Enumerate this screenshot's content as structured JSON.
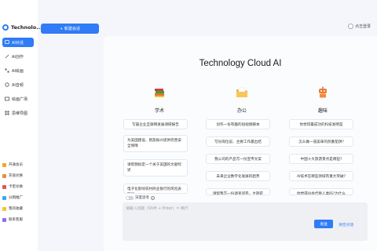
{
  "app": {
    "name": "Technolo..."
  },
  "sidebar": {
    "items": [
      {
        "label": "AI对话",
        "icon": "chat-bubble-icon",
        "active": true
      },
      {
        "label": "AI创作",
        "icon": "pen-icon",
        "active": false
      },
      {
        "label": "AI绘画",
        "icon": "grid-icon",
        "active": false
      },
      {
        "label": "AI音频",
        "icon": "audio-icon",
        "active": false
      },
      {
        "label": "绘画广场",
        "icon": "image-gallery-icon",
        "active": false
      },
      {
        "label": "思维导图",
        "icon": "mindmap-icon",
        "active": false
      }
    ],
    "bottom": [
      {
        "label": "开通会员",
        "icon": "member-icon"
      },
      {
        "label": "充值兑换",
        "icon": "recharge-icon"
      },
      {
        "label": "卡密兑换",
        "icon": "card-code-icon"
      },
      {
        "label": "分销推广",
        "icon": "share-icon"
      },
      {
        "label": "我的收藏",
        "icon": "star-icon"
      },
      {
        "label": "联系客服",
        "icon": "service-icon"
      }
    ]
  },
  "header": {
    "new_chat": "+ 新建会话",
    "login": "点击登录"
  },
  "main": {
    "title": "Technology Cloud AI",
    "columns": [
      {
        "label": "学术",
        "icon": "books-icon",
        "cards": [
          "写篇企业互联网发展调研报告",
          "为美国建设、民族振兴提供完善安全保障",
          "请帮我拟定一个关于美国的文献综述",
          "电子化影响农村商业银行的风险表现吗"
        ]
      },
      {
        "label": "办公",
        "icon": "folder-icon",
        "cards": [
          "创作一份有趣的短视频脚本",
          "写份岗位说、主要工作最出结",
          "我公司的产品写一份宣传文案",
          "未来企业数字化发展的趋势",
          "请帮我写一份调查问卷，主题是"
        ]
      },
      {
        "label": "趣味",
        "icon": "robot-icon",
        "cards": [
          "你觉得最成功的科技发明是",
          "怎么做一道美味的煎番茄饼?",
          "中国十大旅游景点是哪些?",
          "AI技术在哪些领域有重大突破?",
          "你觉得AI会代替人类吗?为什么"
        ]
      }
    ]
  },
  "input": {
    "deep_label": "深度思考",
    "placeholder": "请输入问题（Shift + Enter）= 换行",
    "send": "发送",
    "clear": "清空对话"
  },
  "colors": {
    "accent": "#2f7cf6",
    "background": "#f4f6fb"
  }
}
